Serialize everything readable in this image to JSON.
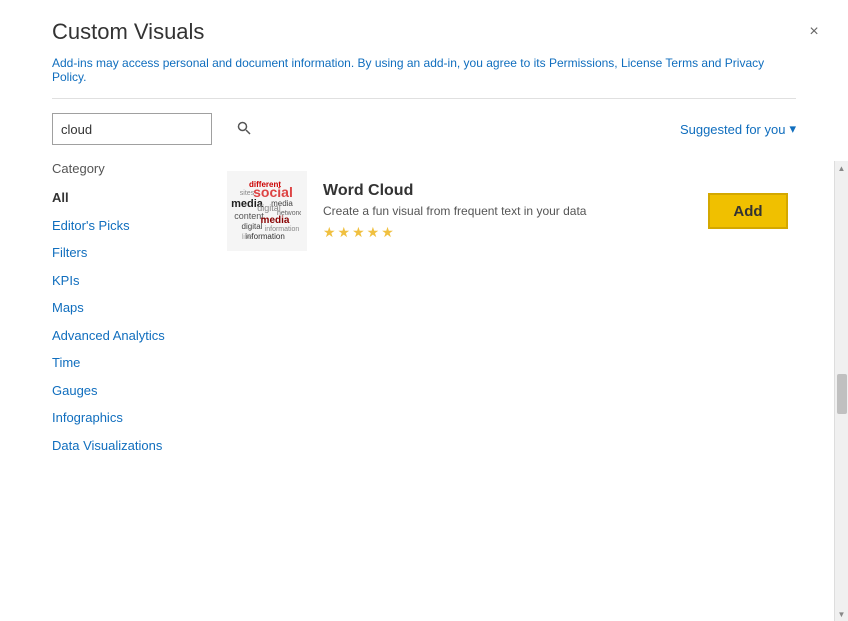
{
  "dialog": {
    "title": "Custom Visuals",
    "info_text": "Add-ins may access personal and document information. By using an add-in, you agree to its Permissions, License Terms and Privacy Policy.",
    "close_label": "×"
  },
  "search": {
    "value": "cloud",
    "placeholder": "cloud",
    "icon": "🔍",
    "suggested_label": "Suggested for you",
    "suggested_arrow": "▾"
  },
  "sidebar": {
    "category_label": "Category",
    "items": [
      {
        "id": "all",
        "label": "All",
        "active": true
      },
      {
        "id": "editors-picks",
        "label": "Editor's Picks",
        "active": false
      },
      {
        "id": "filters",
        "label": "Filters",
        "active": false
      },
      {
        "id": "kpis",
        "label": "KPIs",
        "active": false
      },
      {
        "id": "maps",
        "label": "Maps",
        "active": false
      },
      {
        "id": "advanced-analytics",
        "label": "Advanced Analytics",
        "active": false
      },
      {
        "id": "time",
        "label": "Time",
        "active": false
      },
      {
        "id": "gauges",
        "label": "Gauges",
        "active": false
      },
      {
        "id": "infographics",
        "label": "Infographics",
        "active": false
      },
      {
        "id": "data-visualizations",
        "label": "Data Visualizations",
        "active": false
      }
    ]
  },
  "results": [
    {
      "id": "word-cloud",
      "title": "Word Cloud",
      "description": "Create a fun visual from frequent text in your data",
      "rating": "★★★★★",
      "add_label": "Add"
    }
  ],
  "colors": {
    "accent": "#106ebe",
    "add_btn_bg": "#f0c000",
    "add_btn_border": "#d4a800",
    "star_color": "#f0c040"
  }
}
